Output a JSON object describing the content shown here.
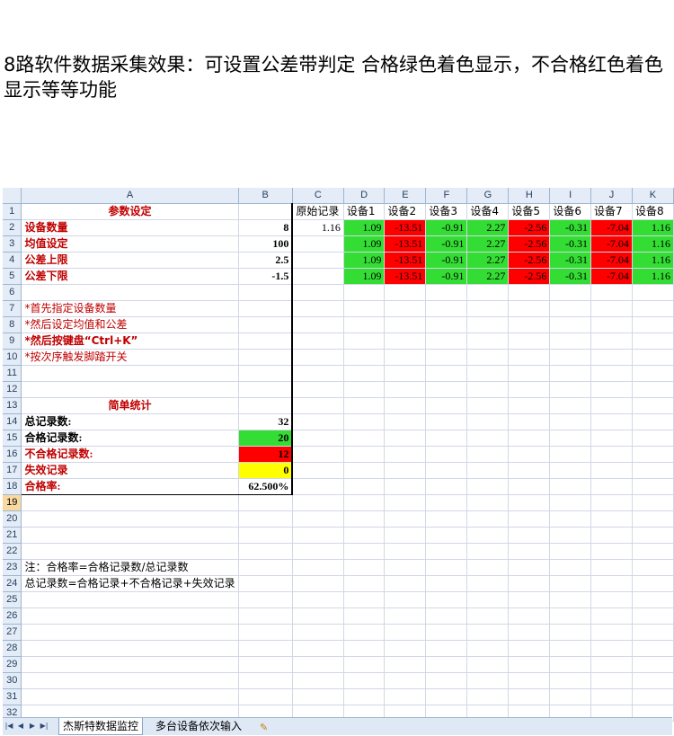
{
  "title": "8路软件数据采集效果：可设置公差带判定 合格绿色着色显示，不合格红色着色显示等等功能",
  "columns": [
    "A",
    "B",
    "C",
    "D",
    "E",
    "F",
    "G",
    "H",
    "I",
    "J",
    "K"
  ],
  "row_numbers": [
    "1",
    "2",
    "3",
    "4",
    "5",
    "6",
    "7",
    "8",
    "9",
    "10",
    "11",
    "12",
    "13",
    "14",
    "15",
    "16",
    "17",
    "18",
    "19",
    "20",
    "21",
    "22",
    "23",
    "24",
    "25",
    "26",
    "27",
    "28",
    "29",
    "30",
    "31",
    "32"
  ],
  "params": {
    "header": "参数设定",
    "device_count_label": "设备数量",
    "device_count": "8",
    "mean_label": "均值设定",
    "mean": "100",
    "upper_label": "公差上限",
    "upper": "2.5",
    "lower_label": "公差下限",
    "lower": "-1.5"
  },
  "notes": [
    "*首先指定设备数量",
    "*然后设定均值和公差",
    "*然后按键盘“Ctrl+K”",
    "*按次序触发脚踏开关"
  ],
  "stats": {
    "header": "简单统计",
    "total_label": "总记录数:",
    "total": "32",
    "pass_label": "合格记录数:",
    "pass": "20",
    "fail_label": "不合格记录数:",
    "fail": "12",
    "invalid_label": "失效记录",
    "invalid": "0",
    "rate_label": "合格率:",
    "rate": "62.500%"
  },
  "raw_header": "原始记录",
  "raw_value": "1.16",
  "devices": [
    "设备1",
    "设备2",
    "设备3",
    "设备4",
    "设备5",
    "设备6",
    "设备7",
    "设备8"
  ],
  "device_values": [
    "1.09",
    "-13.51",
    "-0.91",
    "2.27",
    "-2.56",
    "-0.31",
    "-7.04",
    "1.16"
  ],
  "device_status": [
    "pass",
    "fail",
    "pass",
    "pass",
    "fail",
    "pass",
    "fail",
    "pass"
  ],
  "footnotes": [
    "注：合格率=合格记录数/总记录数",
    "总记录数=合格记录+不合格记录+失效记录"
  ],
  "colors": {
    "pass": "#33dd33",
    "fail": "#ff0000",
    "invalid": "#ffff00",
    "label_red": "#c00000"
  },
  "tabs": [
    "杰斯特数据监控",
    "多台设备依次输入"
  ]
}
